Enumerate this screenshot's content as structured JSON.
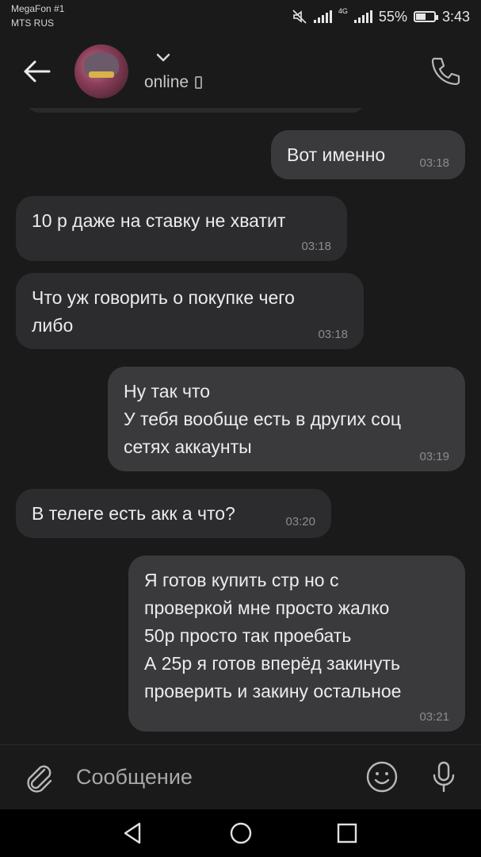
{
  "status_bar": {
    "carrier_1": "MegaFon #1",
    "carrier_2": "MTS RUS",
    "network": "4G",
    "battery": "55%",
    "battery_level": 0.55,
    "time": "3:43"
  },
  "header": {
    "status": "online",
    "icons": [
      "back-arrow-icon",
      "chevron-down-icon",
      "mobile-device-icon",
      "phone-call-icon"
    ]
  },
  "messages": [
    {
      "direction": "out",
      "text": "Вот именно",
      "time": "03:18"
    },
    {
      "direction": "in",
      "text": "10 р даже на ставку не хватит",
      "time": "03:18"
    },
    {
      "direction": "in",
      "text": "Что уж говорить о покупке чего\nлибо",
      "time": "03:18"
    },
    {
      "direction": "out",
      "text": "Ну так что\nУ тебя вообще есть в других соц\nсетях аккаунты",
      "time": "03:19"
    },
    {
      "direction": "in",
      "text": "В телеге есть акк а что?",
      "time": "03:20"
    },
    {
      "direction": "out",
      "text": "Я готов купить стр но с\nпроверкой мне просто жалко\n50р просто так проебать\nА 25р я готов вперёд закинуть\nпроверить и закину остальное",
      "time": "03:21"
    }
  ],
  "input": {
    "placeholder": "Сообщение",
    "value": ""
  },
  "colors": {
    "background": "#1a1a1a",
    "incoming_bubble": "#2c2c2e",
    "outgoing_bubble": "#3a3a3c",
    "text": "#ececec",
    "time": "#8c8c8c"
  }
}
